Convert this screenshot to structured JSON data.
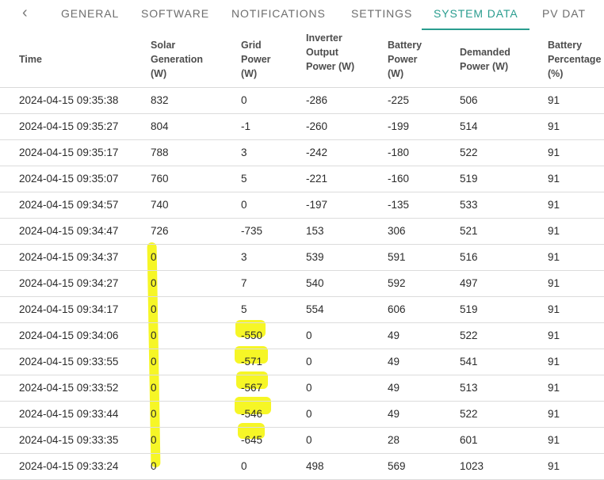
{
  "tabs": {
    "back_glyph": "‹",
    "items": [
      {
        "label": "GENERAL"
      },
      {
        "label": "SOFTWARE"
      },
      {
        "label": "NOTIFICATIONS"
      },
      {
        "label": "SETTINGS"
      },
      {
        "label": "SYSTEM DATA"
      },
      {
        "label": "PV DAT"
      }
    ],
    "active": "SYSTEM DATA",
    "accent_color": "#2a9d8f"
  },
  "table": {
    "headers": [
      {
        "lines": [
          "Time"
        ]
      },
      {
        "lines": [
          "Solar",
          "Generation",
          "(W)"
        ]
      },
      {
        "lines": [
          "Grid",
          "Power",
          "(W)"
        ]
      },
      {
        "lines": [
          "Inverter",
          "Output",
          "Power (W)"
        ]
      },
      {
        "lines": [
          "Battery",
          "Power",
          "(W)"
        ]
      },
      {
        "lines": [
          "Demanded",
          "Power (W)"
        ]
      },
      {
        "lines": [
          "Battery",
          "Percentage",
          "(%)"
        ]
      }
    ],
    "rows": [
      [
        "2024-04-15 09:35:38",
        "832",
        "0",
        "-286",
        "-225",
        "506",
        "91"
      ],
      [
        "2024-04-15 09:35:27",
        "804",
        "-1",
        "-260",
        "-199",
        "514",
        "91"
      ],
      [
        "2024-04-15 09:35:17",
        "788",
        "3",
        "-242",
        "-180",
        "522",
        "91"
      ],
      [
        "2024-04-15 09:35:07",
        "760",
        "5",
        "-221",
        "-160",
        "519",
        "91"
      ],
      [
        "2024-04-15 09:34:57",
        "740",
        "0",
        "-197",
        "-135",
        "533",
        "91"
      ],
      [
        "2024-04-15 09:34:47",
        "726",
        "-735",
        "153",
        "306",
        "521",
        "91"
      ],
      [
        "2024-04-15 09:34:37",
        "0",
        "3",
        "539",
        "591",
        "516",
        "91"
      ],
      [
        "2024-04-15 09:34:27",
        "0",
        "7",
        "540",
        "592",
        "497",
        "91"
      ],
      [
        "2024-04-15 09:34:17",
        "0",
        "5",
        "554",
        "606",
        "519",
        "91"
      ],
      [
        "2024-04-15 09:34:06",
        "0",
        "-550",
        "0",
        "49",
        "522",
        "91"
      ],
      [
        "2024-04-15 09:33:55",
        "0",
        "-571",
        "0",
        "49",
        "541",
        "91"
      ],
      [
        "2024-04-15 09:33:52",
        "0",
        "-567",
        "0",
        "49",
        "513",
        "91"
      ],
      [
        "2024-04-15 09:33:44",
        "0",
        "-546",
        "0",
        "49",
        "522",
        "91"
      ],
      [
        "2024-04-15 09:33:35",
        "0",
        "-645",
        "0",
        "28",
        "601",
        "91"
      ],
      [
        "2024-04-15 09:33:24",
        "0",
        "0",
        "498",
        "569",
        "1023",
        "91"
      ]
    ],
    "highlight_color": "#f5f500"
  }
}
